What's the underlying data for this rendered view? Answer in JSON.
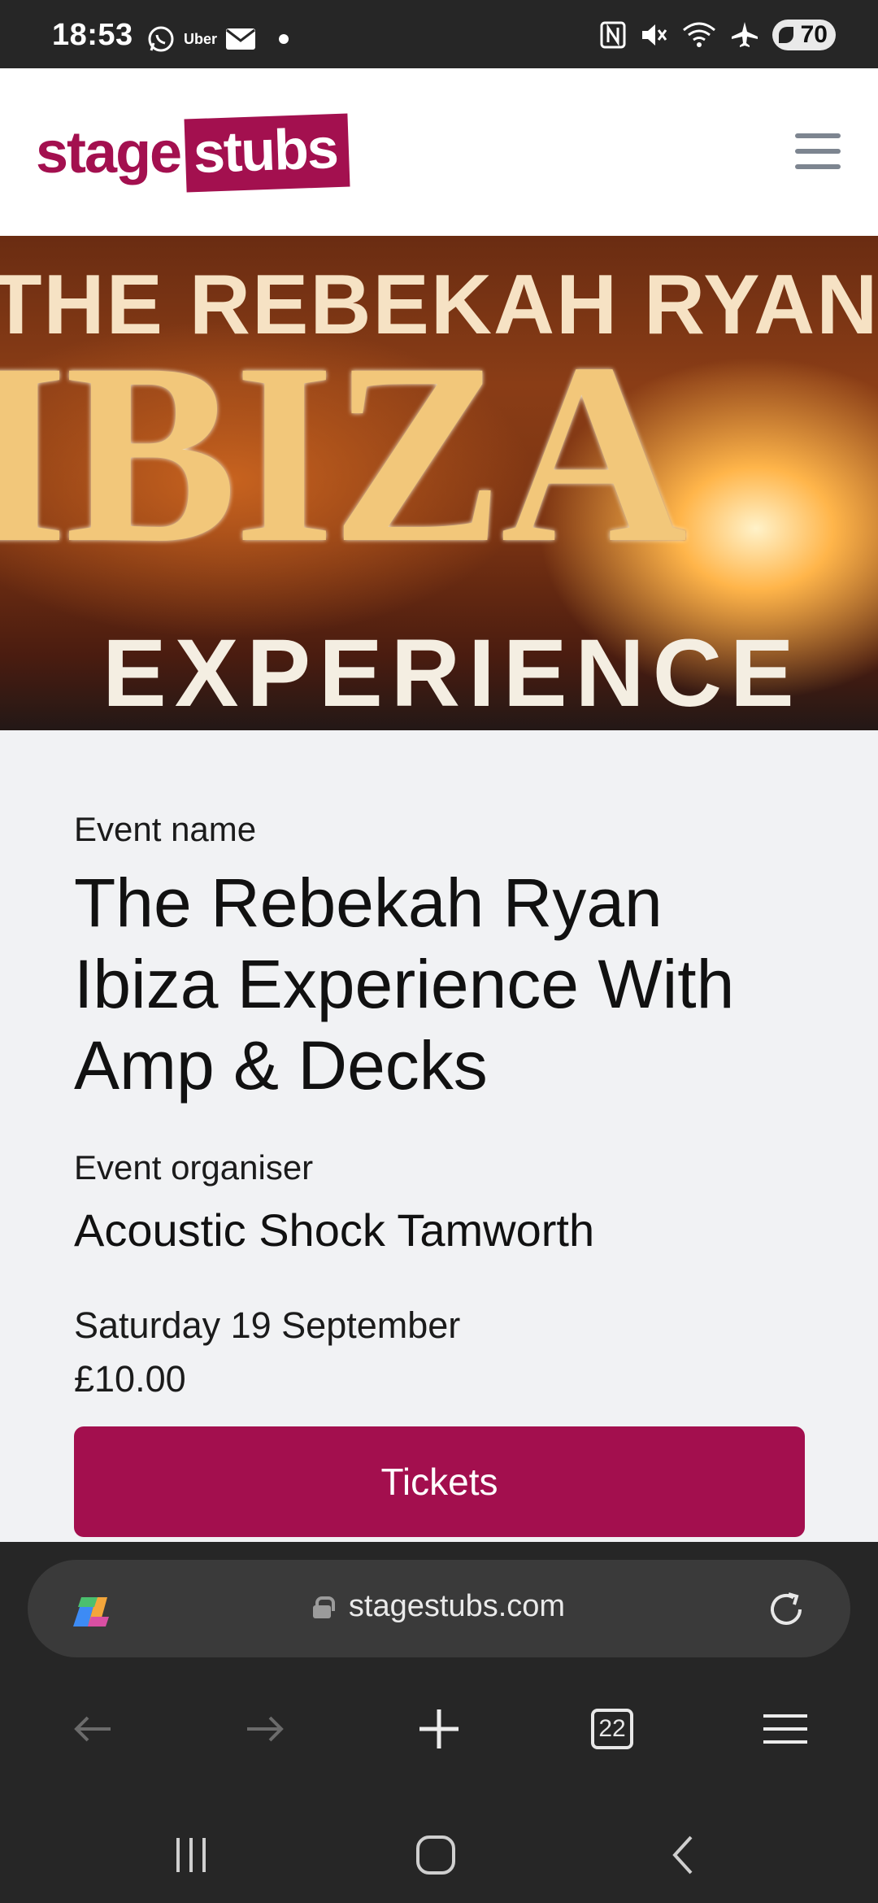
{
  "status_bar": {
    "time": "18:53",
    "notification_icons": [
      "whatsapp-icon",
      "uber-icon",
      "mail-icon",
      "dot-icon"
    ],
    "uber_label": "Uber",
    "system_icons": [
      "nfc-icon",
      "mute-icon",
      "wifi-icon",
      "airplane-icon"
    ],
    "battery": "70"
  },
  "header": {
    "logo_part1": "stage",
    "logo_part2": "stubs",
    "menu_icon": "hamburger-icon",
    "brand_color": "#a3104f"
  },
  "hero": {
    "line1": "THE REBEKAH RYAN",
    "line2": "IBIZA",
    "line3": "EXPERIENCE"
  },
  "event": {
    "name_label": "Event name",
    "name": "The Rebekah Ryan Ibiza Experience With Amp & Decks",
    "organiser_label": "Event organiser",
    "organiser": "Acoustic Shock Tamworth",
    "date": "Saturday 19 September",
    "price": "£10.00",
    "tickets_button": "Tickets"
  },
  "browser": {
    "url": "stagestubs.com",
    "tab_count": "22",
    "icons": [
      "copilot-icon",
      "lock-icon",
      "reload-icon",
      "back-icon",
      "forward-icon",
      "new-tab-icon",
      "tabs-icon",
      "menu-icon"
    ]
  },
  "system_nav": {
    "icons": [
      "recents-icon",
      "home-icon",
      "back-icon"
    ]
  }
}
